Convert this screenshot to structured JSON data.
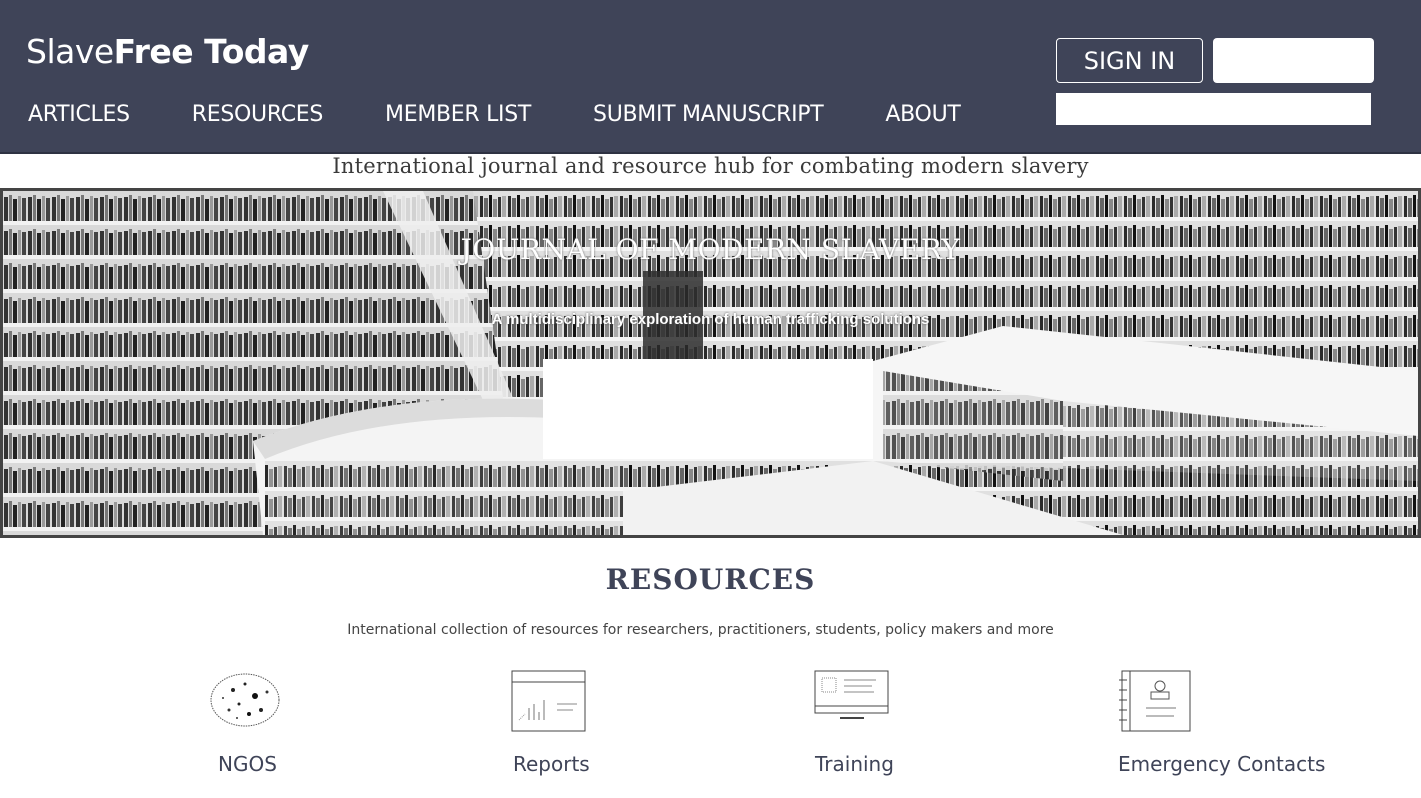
{
  "header": {
    "logo_light": "Slave",
    "logo_bold": "Free Today",
    "nav": [
      "ARTICLES",
      "RESOURCES",
      "MEMBER LIST",
      "SUBMIT MANUSCRIPT",
      "ABOUT"
    ],
    "sign_in_label": "SIGN IN",
    "colors": {
      "bar": "#3f4458",
      "text": "#ffffff"
    }
  },
  "tagline": "International journal and resource hub for combating modern slavery",
  "hero": {
    "title": "JOURNAL OF MODERN SLAVERY",
    "subtitle": "A multidisciplinary exploration of human trafficking solutions"
  },
  "resources": {
    "title": "RESOURCES",
    "subtitle": "International collection of resources for researchers, practitioners, students, policy makers and more",
    "items": [
      {
        "label": "NGOS",
        "icon": "globe-dots-icon"
      },
      {
        "label": "Reports",
        "icon": "report-chart-icon"
      },
      {
        "label": "Training",
        "icon": "monitor-presentation-icon"
      },
      {
        "label": "Emergency Contacts",
        "icon": "contact-book-icon"
      }
    ]
  }
}
